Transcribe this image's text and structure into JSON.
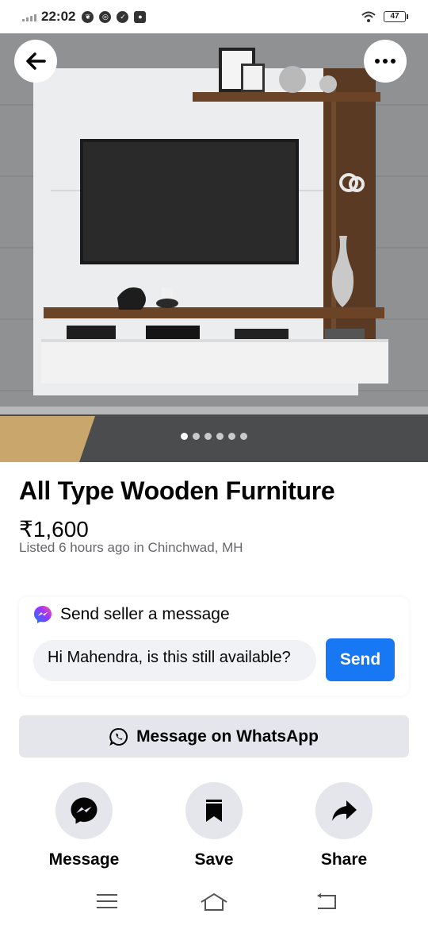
{
  "status_bar": {
    "time": "22:02",
    "battery": "47",
    "icons": [
      "leaf-icon",
      "chrome-icon",
      "check-icon",
      "mic-icon"
    ],
    "wifi": "wifi-icon"
  },
  "hero": {
    "image_label": "TV unit wall mount furniture photo",
    "page_count": 6,
    "active_index": 0
  },
  "listing": {
    "title": "All Type Wooden Furniture",
    "price": "₹1,600",
    "listed": "Listed 6 hours ago in Chinchwad, MH"
  },
  "message_card": {
    "header": "Send seller a message",
    "input_value": "Hi Mahendra, is this still available?",
    "send_label": "Send"
  },
  "whatsapp": {
    "label": "Message on WhatsApp"
  },
  "actions": [
    {
      "label": "Message",
      "icon": "messenger-icon"
    },
    {
      "label": "Save",
      "icon": "bookmark-icon"
    },
    {
      "label": "Share",
      "icon": "share-icon"
    }
  ],
  "colors": {
    "accent": "#1877f2",
    "button_bg": "#e4e6eb",
    "secondary_text": "#65676b"
  }
}
